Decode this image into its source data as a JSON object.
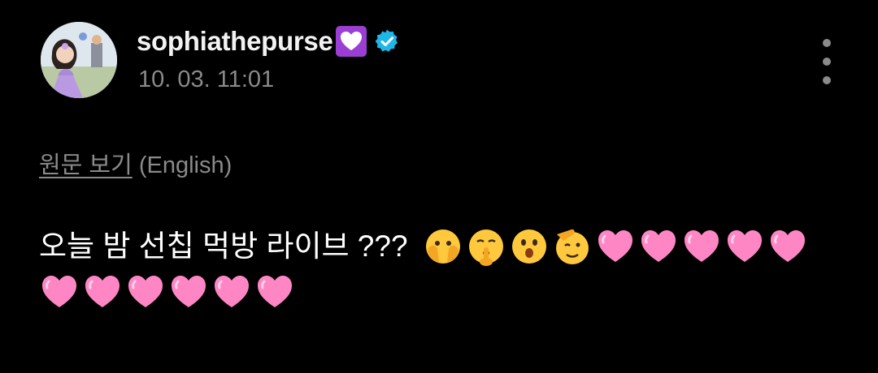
{
  "post": {
    "username": "sophiathepurse",
    "username_badge": "purple-heart-badge-icon",
    "verified_icon": "verified-badge-icon",
    "timestamp": "10. 03. 11:01",
    "more_icon": "more-options-icon"
  },
  "translation": {
    "view_original": "원문 보기",
    "language_note": "(English)"
  },
  "body": {
    "text": "오늘 밤 선칩 먹방 라이브 ???",
    "emojis": [
      "face-with-open-eyes-and-hand-over-mouth-icon",
      "shushing-face-icon",
      "hushed-face-icon",
      "saluting-face-icon",
      "pink-heart-icon",
      "pink-heart-icon",
      "pink-heart-icon",
      "pink-heart-icon",
      "pink-heart-icon",
      "pink-heart-icon",
      "pink-heart-icon",
      "pink-heart-icon",
      "pink-heart-icon",
      "pink-heart-icon",
      "pink-heart-icon"
    ]
  },
  "colors": {
    "background": "#000000",
    "primary_text": "#ffffff",
    "secondary_text": "#8a8a8a",
    "verified": "#1fb6e8",
    "badge_purple": "#9b3fd4",
    "heart_pink": "#ff7fbf"
  }
}
